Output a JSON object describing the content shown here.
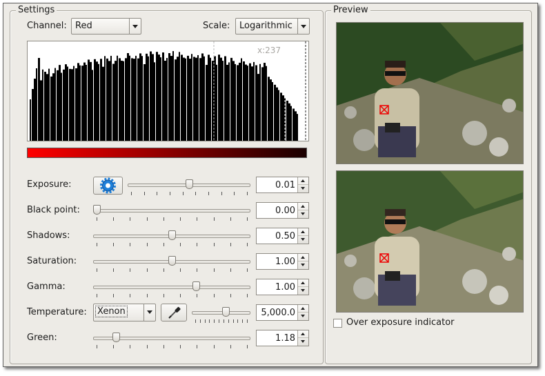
{
  "settings": {
    "title": "Settings",
    "channel_label": "Channel:",
    "channel_value": "Red",
    "scale_label": "Scale:",
    "scale_value": "Logarithmic",
    "histogram_readout": "x:237",
    "controls": [
      {
        "label": "Exposure:",
        "value": "0.01",
        "level": 0.5
      },
      {
        "label": "Black point:",
        "value": "0.00",
        "level": 0.0
      },
      {
        "label": "Shadows:",
        "value": "0.50",
        "level": 0.5
      },
      {
        "label": "Saturation:",
        "value": "1.00",
        "level": 0.5
      },
      {
        "label": "Gamma:",
        "value": "1.00",
        "level": 0.66
      },
      {
        "label": "Temperature:",
        "value": "5,000.0",
        "level": 0.58,
        "preset": "Xenon"
      },
      {
        "label": "Green:",
        "value": "1.18",
        "level": 0.13
      }
    ]
  },
  "preview": {
    "title": "Preview",
    "overexposure_label": "Over exposure indicator",
    "overexposure_checked": false
  },
  "colors": {
    "gradient_start": "#ff0000",
    "gradient_end": "#1a0000",
    "window_bg": "#edebe6"
  },
  "icons": {
    "auto_exposure": "gear-icon",
    "color_picker": "eyedropper-icon"
  }
}
